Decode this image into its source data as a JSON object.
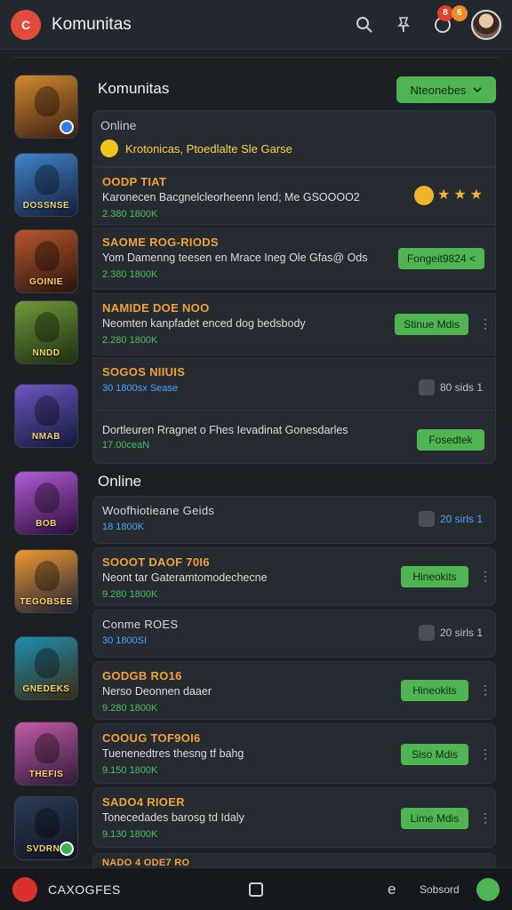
{
  "header": {
    "logo": "C",
    "title": "Komunitas",
    "badge_red": "8",
    "badge_orange": "6"
  },
  "sections": {
    "first_title": "Komunitas",
    "dropdown_label": "Nteonebes",
    "second_title": "Online"
  },
  "thumbnails": [
    {
      "label": "",
      "colors": [
        "#d28a2f",
        "#3a1f12"
      ]
    },
    {
      "label": "DOSSNSE",
      "colors": [
        "#3f86c9",
        "#141d3c"
      ]
    },
    {
      "label": "GOINIE",
      "colors": [
        "#b8572c",
        "#2a140e"
      ]
    },
    {
      "label": "NNDD",
      "colors": [
        "#6f9a3a",
        "#1f2d12"
      ]
    },
    {
      "label": "NMAB",
      "colors": [
        "#6e55c2",
        "#101a3a"
      ]
    },
    {
      "label": "BOB",
      "colors": [
        "#b25bd6",
        "#2a0f3a"
      ]
    },
    {
      "label": "TEGOBSEE",
      "colors": [
        "#f09a2f",
        "#1d2038"
      ]
    },
    {
      "label": "GNEDEKS",
      "colors": [
        "#1d8fb0",
        "#3a2a12"
      ]
    },
    {
      "label": "THEFIS",
      "colors": [
        "#c55aa8",
        "#2d1b3a"
      ]
    },
    {
      "label": "SVDRNE",
      "colors": [
        "#2b3a55",
        "#0f1522"
      ]
    }
  ],
  "group1": {
    "online_label": "Online",
    "highlight_text": "Krotonicas, Ptoedlalte Sle Garse",
    "rows": [
      {
        "title": "OODP TIAT",
        "desc": "Karonecen Bacgnelcleorheenn lend; Me GSOOOO2",
        "meta": "2.380 1800K"
      },
      {
        "title": "SAOME ROG-RIODS",
        "desc": "Yom Damenng teesen en Mrace Ineg Ole Gfas@ Ods",
        "meta": "2.380 1800K",
        "button": "Fongeit9824 <"
      },
      {
        "title": "NAMIDE DOE NOO",
        "desc": "Neomten kanpfadet enced dog bedsbody",
        "meta": "2.280 1800K",
        "button": "Stinue Mdis"
      },
      {
        "title": "SOGOS NIIUIS",
        "meta": "30 1800sx Sease",
        "stat": "80 sids 1"
      },
      {
        "title": "",
        "desc": "Dortleuren Rragnet o Fhes Ievadinat Gonesdarles",
        "meta": "17.00ceaN",
        "button": "Fosedtek"
      }
    ]
  },
  "list2": [
    {
      "title": "Woofhiotieane Geids",
      "meta": "18 1800K",
      "stat": "20 sirls 1"
    },
    {
      "title": "SOOOT DAOF 70I6",
      "desc": "Neont tar Gateramtomodechecne",
      "meta": "9.280 1800K",
      "button": "Hineokits"
    },
    {
      "title": "Conme ROES",
      "meta": "30 1800SI",
      "stat": "20 sirls 1"
    },
    {
      "title": "GODGB RO16",
      "desc": "Nerso Deonnen daaer",
      "meta": "9.280 1800K",
      "button": "Hineokits"
    },
    {
      "title": "COOUG TOF9OI6",
      "desc": "Tuenenedtres thesng tf bahg",
      "meta": "9.150 1800K",
      "button": "Siso Mdis"
    },
    {
      "title": "SADO4 RIOER",
      "desc": "Tonecedades barosg td Idaly",
      "meta": "9.130 1800K",
      "button": "Lime Mdis"
    },
    {
      "title": "NADO 4 ODE7 RO"
    }
  ],
  "bottom_nav": {
    "label": "CAXOGFES",
    "label2": "Sobsord",
    "e": "e"
  }
}
